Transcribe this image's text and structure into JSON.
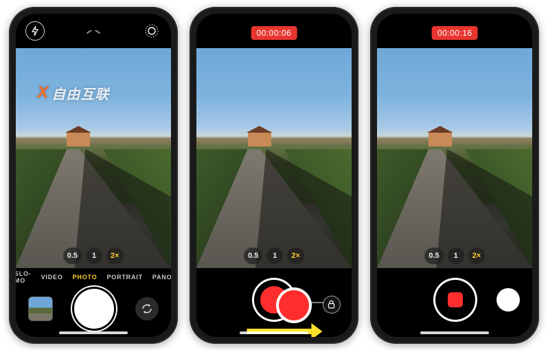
{
  "watermark": {
    "x_label": "X",
    "text": "自由互联"
  },
  "zoom": {
    "levels": [
      "0.5",
      "1",
      "2×"
    ],
    "active_index": 2
  },
  "modes": {
    "items": [
      "SLO-MO",
      "VIDEO",
      "PHOTO",
      "PORTRAIT",
      "PANO"
    ],
    "active_index": 2
  },
  "icons": {
    "flash": "bolt-icon",
    "live_photo": "live-photo-icon",
    "chevron": "chevron-up-icon",
    "switch_camera": "switch-camera-icon",
    "lock": "lock-icon"
  },
  "phones": [
    {
      "id": "photo-mode",
      "show_timer": false,
      "timer": "",
      "show_modes": true,
      "shutter_style": "photo",
      "show_lock_hint": false,
      "show_drag_arrow": false,
      "show_dragged_shutter": false,
      "left_slot": "thumbnail",
      "right_slot": "switch-dark"
    },
    {
      "id": "quicktake-dragging",
      "show_timer": true,
      "timer": "00:00:06",
      "show_modes": false,
      "shutter_style": "record",
      "show_lock_hint": true,
      "show_drag_arrow": true,
      "show_dragged_shutter": true,
      "left_slot": "none",
      "right_slot": "none"
    },
    {
      "id": "quicktake-locked",
      "show_timer": true,
      "timer": "00:00:16",
      "show_modes": false,
      "shutter_style": "record-locked",
      "show_lock_hint": false,
      "show_drag_arrow": false,
      "show_dragged_shutter": false,
      "left_slot": "none",
      "right_slot": "switch-white"
    }
  ]
}
